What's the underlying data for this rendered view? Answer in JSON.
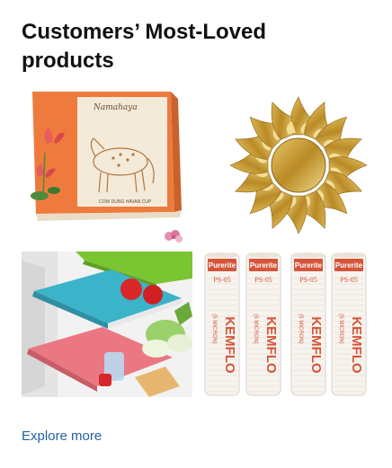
{
  "card": {
    "title": "Customers’ Most-Loved products",
    "explore_label": "Explore more"
  },
  "products": [
    {
      "name": "cow-dung-havan-cup-box",
      "brand_script": "Namahaya",
      "box_caption": "COW DUNG HAVAN CUP"
    },
    {
      "name": "sun-mirror-wall-sticker"
    },
    {
      "name": "fridge-mat-sheets"
    },
    {
      "name": "purerite-pp-filter-cartridges",
      "brand": "Purerite",
      "model": "PS-05",
      "label": "KEMFLO",
      "micron": "(5 MICRON)"
    }
  ],
  "colors": {
    "title": "#0f1111",
    "link": "#2162a1",
    "box_orange": "#ef7a3c",
    "mirror_gold": "#c89a2c",
    "mat_green": "#79c431",
    "mat_blue": "#3bb0c6",
    "mat_pink": "#e9757d",
    "filter_red": "#d4553a"
  }
}
